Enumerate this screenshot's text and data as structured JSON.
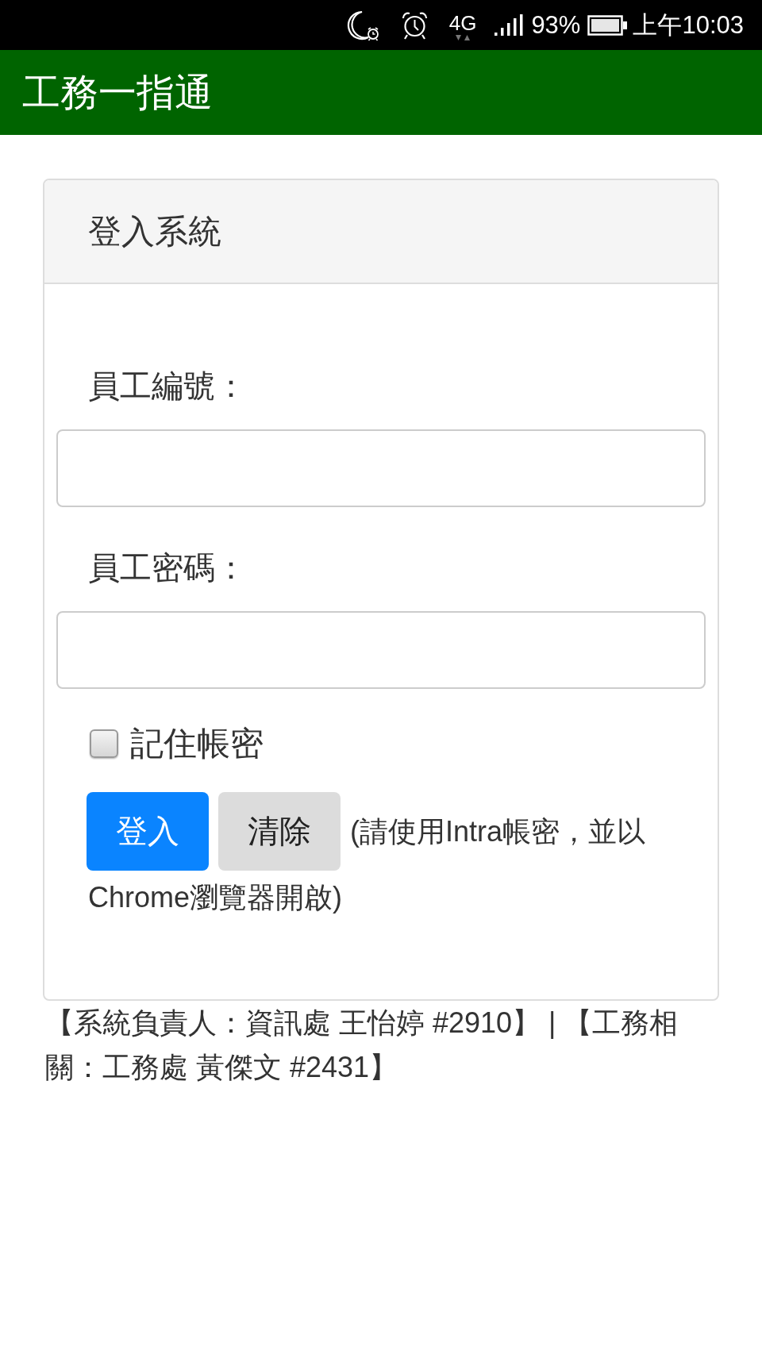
{
  "status_bar": {
    "network": "4G",
    "battery": "93%",
    "time": "上午10:03"
  },
  "app_bar": {
    "title": "工務一指通"
  },
  "login_card": {
    "title": "登入系統",
    "fields": [
      {
        "label": "員工編號："
      },
      {
        "label": "員工密碼："
      }
    ],
    "remember": {
      "label": "記住帳密",
      "checked": false
    },
    "buttons": [
      {
        "label": "登入",
        "kind": "primary"
      },
      {
        "label": "清除",
        "kind": "secondary"
      }
    ],
    "hint_lines": [
      "(請使用Intra帳密，並以",
      "Chrome瀏覽器開啟)"
    ]
  },
  "footer": "【系統負責人：資訊處 王怡婷 #2910】 | 【工務相關：工務處 黃傑文 #2431】"
}
